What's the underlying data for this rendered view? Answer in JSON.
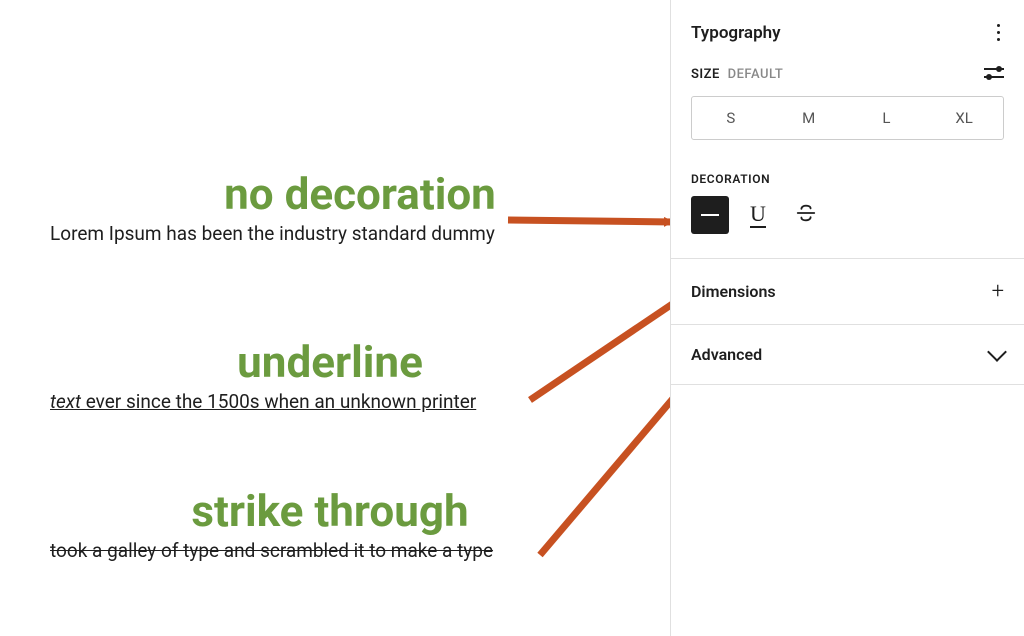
{
  "examples": {
    "none": {
      "heading": "no decoration",
      "text": "Lorem Ipsum has been the industry standard dummy"
    },
    "underline": {
      "heading": "underline",
      "text_italic": "text",
      "text_rest": " ever since the 1500s when an unknown printer "
    },
    "strike": {
      "heading": "strike through",
      "text": "took a galley of type and scrambled it to make a type"
    }
  },
  "sidebar": {
    "typography_label": "Typography",
    "size_label": "SIZE",
    "size_default_label": " DEFAULT",
    "sizes": [
      "S",
      "M",
      "L",
      "XL"
    ],
    "decoration_label": "DECORATION",
    "dimensions_label": "Dimensions",
    "advanced_label": "Advanced"
  },
  "annotation": {
    "arrow_color": "#c75121"
  }
}
